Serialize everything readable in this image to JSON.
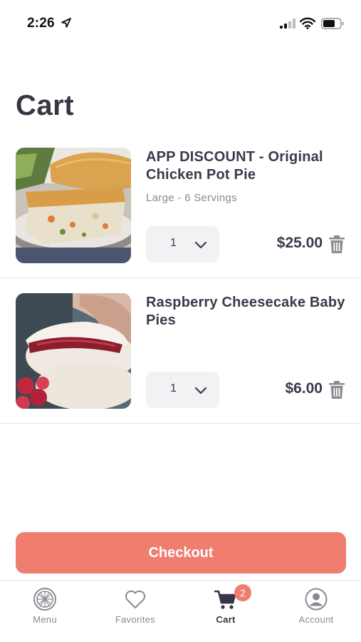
{
  "status_bar": {
    "time": "2:26",
    "icons": [
      "location-arrow-icon",
      "cellular-signal-icon",
      "wifi-icon",
      "battery-icon"
    ]
  },
  "page": {
    "title": "Cart"
  },
  "cart_items": [
    {
      "title": "APP DISCOUNT - Original Chicken Pot Pie",
      "variant": "Large - 6 Servings",
      "quantity": "1",
      "price": "$25.00"
    },
    {
      "title": "Raspberry Cheesecake Baby Pies",
      "variant": "",
      "quantity": "1",
      "price": "$6.00"
    }
  ],
  "checkout": {
    "label": "Checkout"
  },
  "tab_bar": {
    "tabs": [
      {
        "label": "Menu",
        "icon": "pie-icon",
        "active": false
      },
      {
        "label": "Favorites",
        "icon": "heart-icon",
        "active": false
      },
      {
        "label": "Cart",
        "icon": "cart-icon",
        "active": true
      },
      {
        "label": "Account",
        "icon": "user-icon",
        "active": false
      }
    ],
    "cart_badge": "2"
  },
  "colors": {
    "accent": "#ef7d70",
    "text_dark": "#363646",
    "text_muted": "#8a8a92",
    "qty_bg": "#f2f2f5",
    "divider": "#e3e3e6"
  }
}
